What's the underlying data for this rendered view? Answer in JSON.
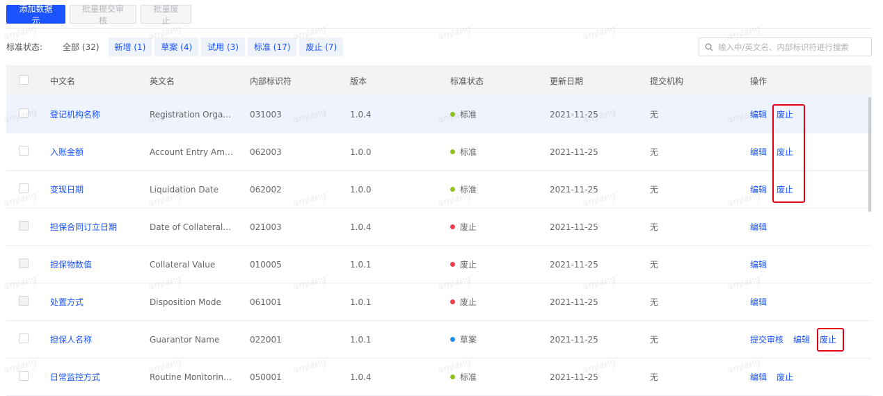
{
  "toolbar": {
    "add_label": "添加数据元",
    "batch_submit_label": "批量提交审核",
    "batch_abolish_label": "批量废止"
  },
  "filter": {
    "label": "标准状态:",
    "chips": [
      {
        "label": "全部 (32)"
      },
      {
        "label": "新增 (1)"
      },
      {
        "label": "草案 (4)"
      },
      {
        "label": "试用 (3)"
      },
      {
        "label": "标准 (17)"
      },
      {
        "label": "废止 (7)"
      }
    ]
  },
  "search": {
    "placeholder": "输入中/英文名、内部标识符进行搜索",
    "icon": "search-icon"
  },
  "table": {
    "headers": {
      "cn_name": "中文名",
      "en_name": "英文名",
      "internal_id": "内部标识符",
      "version": "版本",
      "status": "标准状态",
      "updated": "更新日期",
      "org": "提交机构",
      "ops": "操作"
    },
    "rows": [
      {
        "cn": "登记机构名称",
        "en": "Registration Organi...",
        "id": "031003",
        "ver": "1.0.4",
        "status": "标准",
        "status_color": "#8ec21f",
        "date": "2021-11-25",
        "org": "无",
        "ops": [
          "编辑",
          "废止"
        ]
      },
      {
        "cn": "入账金额",
        "en": "Account Entry Amount",
        "id": "062003",
        "ver": "1.0.0",
        "status": "标准",
        "status_color": "#8ec21f",
        "date": "2021-11-25",
        "org": "无",
        "ops": [
          "编辑",
          "废止"
        ]
      },
      {
        "cn": "变现日期",
        "en": "Liquidation Date",
        "id": "062002",
        "ver": "1.0.0",
        "status": "标准",
        "status_color": "#8ec21f",
        "date": "2021-11-25",
        "org": "无",
        "ops": [
          "编辑",
          "废止"
        ]
      },
      {
        "cn": "担保合同订立日期",
        "en": "Date of Collateral C...",
        "id": "021003",
        "ver": "1.0.4",
        "status": "废止",
        "status_color": "#ef3c4a",
        "date": "2021-11-25",
        "org": "无",
        "ops": [
          "编辑"
        ]
      },
      {
        "cn": "担保物数值",
        "en": "Collateral Value",
        "id": "010005",
        "ver": "1.0.1",
        "status": "废止",
        "status_color": "#ef3c4a",
        "date": "2021-11-25",
        "org": "无",
        "ops": [
          "编辑"
        ]
      },
      {
        "cn": "处置方式",
        "en": "Disposition Mode",
        "id": "061001",
        "ver": "1.0.1",
        "status": "废止",
        "status_color": "#ef3c4a",
        "date": "2021-11-25",
        "org": "无",
        "ops": [
          "编辑"
        ]
      },
      {
        "cn": "担保人名称",
        "en": "Guarantor Name",
        "id": "022001",
        "ver": "1.0.1",
        "status": "草案",
        "status_color": "#1f8ff0",
        "date": "2021-11-25",
        "org": "无",
        "ops": [
          "提交审核",
          "编辑",
          "废止"
        ]
      },
      {
        "cn": "日常监控方式",
        "en": "Routine Monitoring ...",
        "id": "050001",
        "ver": "1.0.4",
        "status": "标准",
        "status_color": "#8ec21f",
        "date": "2021-11-25",
        "org": "无",
        "ops": [
          "编辑",
          "废止"
        ]
      }
    ]
  },
  "watermark": "anyang"
}
